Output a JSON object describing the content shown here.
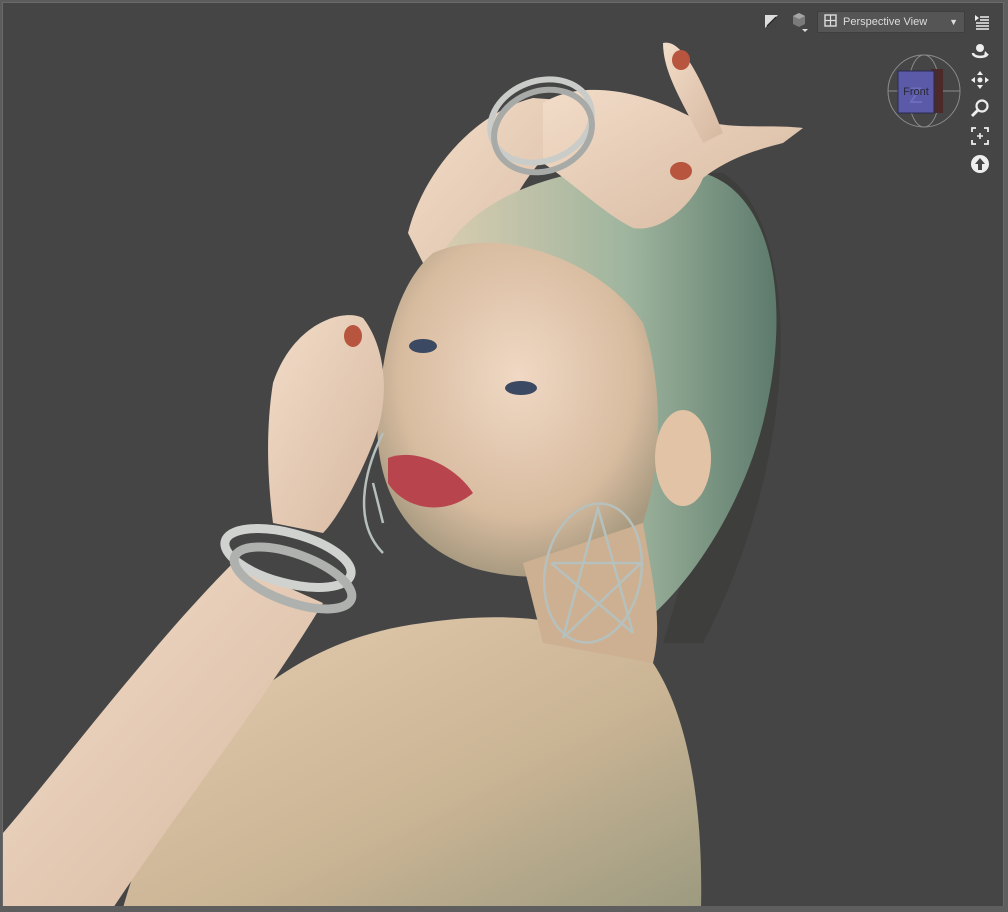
{
  "viewport": {
    "view_mode": "Perspective View",
    "background_color": "#454545",
    "scene_description": "3D render of a woman with blonde/green-tinted hair, silver bangle bracelets and geometric hoop earrings, looking over her bare shoulder"
  },
  "toolbar": {
    "icons": [
      "draw-style-icon",
      "camera-cube-icon",
      "view-layout-icon",
      "options-menu-icon"
    ],
    "dropdown_arrow": "▼"
  },
  "cube_widget": {
    "face_label": "Front",
    "axis_label": "Z"
  },
  "nav_controls": {
    "icons": [
      "orbit-icon",
      "pan-icon",
      "zoom-icon",
      "frame-icon",
      "reset-view-icon"
    ]
  }
}
